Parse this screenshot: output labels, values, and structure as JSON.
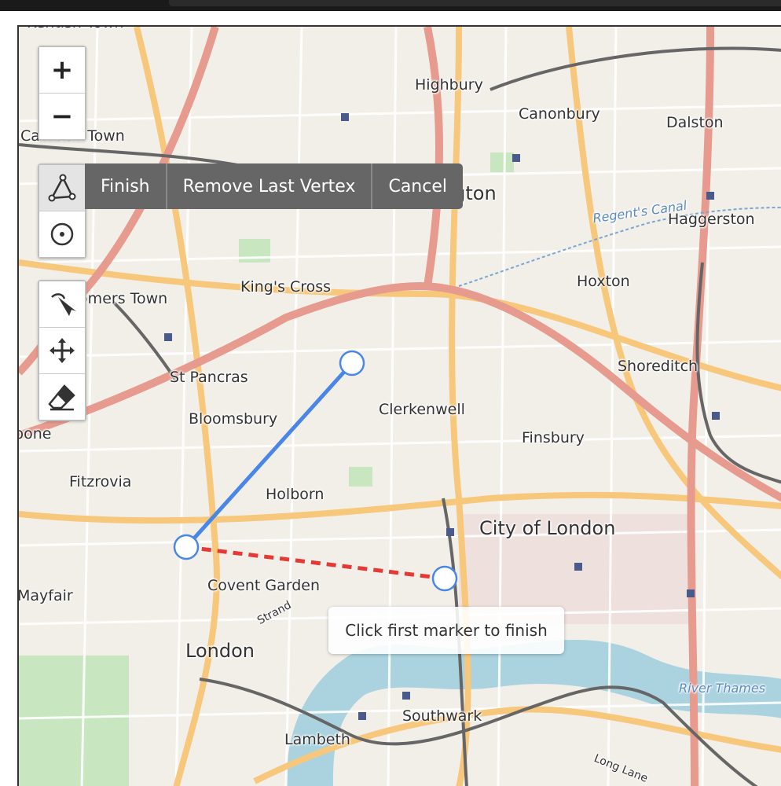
{
  "zoom_control": {
    "zoom_in_label": "+",
    "zoom_out_label": "−"
  },
  "draw_toolbar": {
    "tools": [
      {
        "icon": "polyline-icon",
        "active": true
      },
      {
        "icon": "circle-marker-icon",
        "active": false
      }
    ],
    "actions": {
      "finish": "Finish",
      "remove_last_vertex": "Remove Last Vertex",
      "cancel": "Cancel"
    }
  },
  "edit_toolbar": {
    "tools": [
      {
        "icon": "cut-icon"
      },
      {
        "icon": "move-icon"
      },
      {
        "icon": "eraser-icon"
      }
    ]
  },
  "tooltip": {
    "text": "Click first marker to finish"
  },
  "drawing": {
    "line_color": "#4a86e8",
    "guide_color": "#e53935"
  },
  "map_labels": {
    "kentish_town": "Kentish Town",
    "highbury": "Highbury",
    "canonbury": "Canonbury",
    "dalston": "Dalston",
    "camden_town": "Camden Town",
    "islington": "Islington",
    "regents_canal": "Regent's Canal",
    "haggerston": "Haggerston",
    "hoxton": "Hoxton",
    "somers_town": "Somers Town",
    "kings_cross": "King's Cross",
    "shoreditch": "Shoreditch",
    "st_pancras": "St Pancras",
    "clerkenwell": "Clerkenwell",
    "bloomsbury": "Bloomsbury",
    "marylebone": "Marylebone",
    "finsbury": "Finsbury",
    "fitzrovia": "Fitzrovia",
    "holborn": "Holborn",
    "city_of_london": "City of London",
    "mayfair": "Mayfair",
    "covent_garden": "Covent Garden",
    "strand": "Strand",
    "london": "London",
    "river_thames": "River Thames",
    "southwark": "Southwark",
    "lambeth": "Lambeth",
    "long_lane": "Long Lane"
  }
}
